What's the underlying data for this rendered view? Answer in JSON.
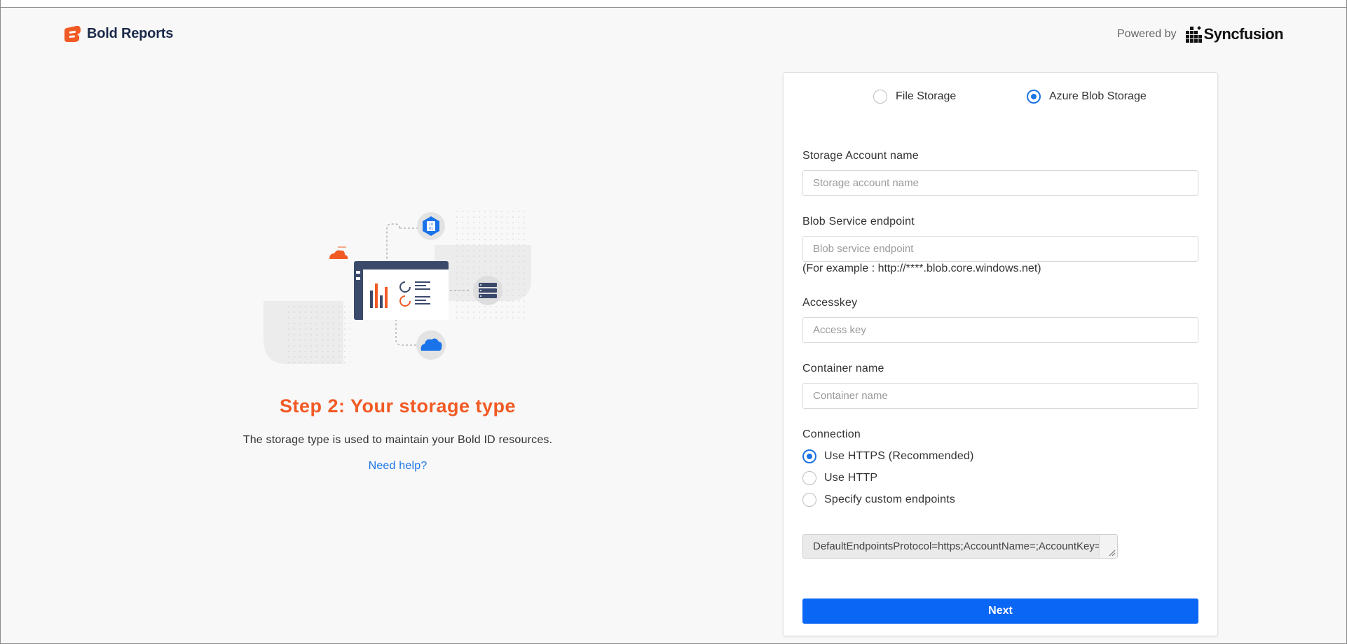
{
  "header": {
    "brand_name": "Bold Reports",
    "powered_by_label": "Powered by",
    "partner_name": "Syncfusion"
  },
  "intro": {
    "title": "Step 2: Your storage type",
    "description": "The storage type is used to maintain your Bold ID resources.",
    "help_link": "Need help?"
  },
  "storage_types": [
    {
      "label": "File Storage",
      "selected": false
    },
    {
      "label": "Azure Blob Storage",
      "selected": true
    }
  ],
  "fields": {
    "account_name": {
      "label": "Storage Account name",
      "placeholder": "Storage account name",
      "value": ""
    },
    "blob_endpoint": {
      "label": "Blob Service endpoint",
      "placeholder": "Blob service endpoint",
      "value": "",
      "hint": "(For example : http://****.blob.core.windows.net)"
    },
    "access_key": {
      "label": "Accesskey",
      "placeholder": "Access key",
      "value": ""
    },
    "container_name": {
      "label": "Container name",
      "placeholder": "Container name",
      "value": ""
    }
  },
  "connection": {
    "label": "Connection",
    "options": [
      {
        "label": "Use HTTPS (Recommended)",
        "selected": true
      },
      {
        "label": "Use HTTP",
        "selected": false
      },
      {
        "label": "Specify custom endpoints",
        "selected": false
      }
    ],
    "connection_string": "DefaultEndpointsProtocol=https;AccountName=;AccountKey="
  },
  "actions": {
    "next_label": "Next"
  },
  "colors": {
    "brand_orange": "#f15a24",
    "primary_blue": "#0a66f5",
    "link_blue": "#1a73e8",
    "navy": "#3b4a6b"
  }
}
